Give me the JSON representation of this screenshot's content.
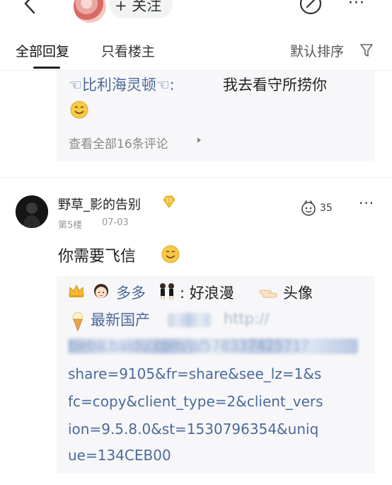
{
  "header": {
    "follow_label": "+ 关注",
    "more_label": "···"
  },
  "tabs": {
    "all": "全部回复",
    "op_only": "只看楼主",
    "sort": "默认排序"
  },
  "reply1": {
    "user": "☜比利海灵顿☜:",
    "text": "我去看守所捞你",
    "view_all": "查看全部16条评论"
  },
  "floor5": {
    "username": "野草_影的告别",
    "floor": "第5楼",
    "date": "07-03",
    "likes": "35",
    "more_label": "···",
    "content": "你需要飞信"
  },
  "reply2": {
    "user": "多多",
    "text1": ": 好浪漫",
    "text2": "头像",
    "link_prefix": "最新国产",
    "http": "http://",
    "blurred_url": "tieba.baidu.com/p/57833742571?",
    "url_lines": [
      "share=9105&fr=share&see_lz=1&s",
      "fc=copy&client_type=2&client_vers",
      "ion=9.5.8.0&st=1530796354&uniq",
      "ue=134CEB00"
    ]
  },
  "colors": {
    "link_blue": "#4b6a9b",
    "reply_bg": "#f7f7f9",
    "meta_gray": "#999999"
  }
}
